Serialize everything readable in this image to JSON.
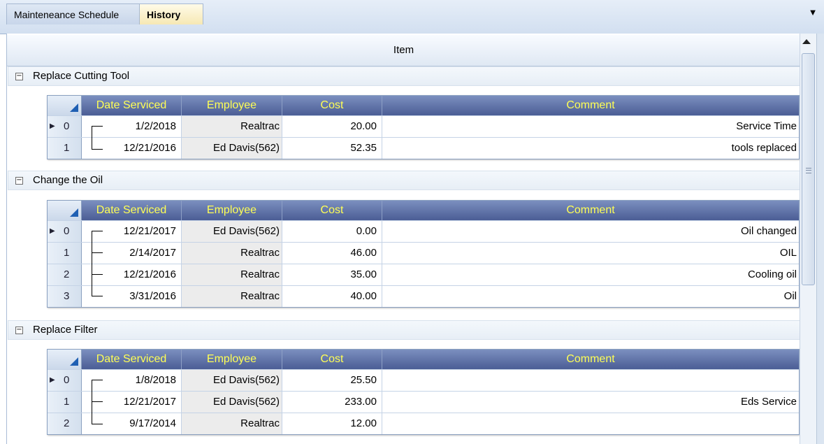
{
  "tabs": [
    {
      "label": "Mainteneance Schedule"
    },
    {
      "label": "History"
    }
  ],
  "grid": {
    "column_header": "Item",
    "detail_columns": [
      "Date Serviced",
      "Employee",
      "Cost",
      "Comment"
    ],
    "groups": [
      {
        "title": "Replace Cutting Tool",
        "rows": [
          {
            "index": "0",
            "date": "1/2/2018",
            "employee": "Realtrac",
            "cost": "20.00",
            "comment": "Service Time"
          },
          {
            "index": "1",
            "date": "12/21/2016",
            "employee": "Ed Davis(562)",
            "cost": "52.35",
            "comment": "tools replaced"
          }
        ]
      },
      {
        "title": "Change the Oil",
        "rows": [
          {
            "index": "0",
            "date": "12/21/2017",
            "employee": "Ed Davis(562)",
            "cost": "0.00",
            "comment": "Oil changed"
          },
          {
            "index": "1",
            "date": "2/14/2017",
            "employee": "Realtrac",
            "cost": "46.00",
            "comment": "OIL"
          },
          {
            "index": "2",
            "date": "12/21/2016",
            "employee": "Realtrac",
            "cost": "35.00",
            "comment": "Cooling oil"
          },
          {
            "index": "3",
            "date": "3/31/2016",
            "employee": "Realtrac",
            "cost": "40.00",
            "comment": "Oil"
          }
        ]
      },
      {
        "title": "Replace Filter",
        "rows": [
          {
            "index": "0",
            "date": "1/8/2018",
            "employee": "Ed Davis(562)",
            "cost": "25.50",
            "comment": ""
          },
          {
            "index": "1",
            "date": "12/21/2017",
            "employee": "Ed Davis(562)",
            "cost": "233.00",
            "comment": "Eds Service"
          },
          {
            "index": "2",
            "date": "9/17/2014",
            "employee": "Realtrac",
            "cost": "12.00",
            "comment": ""
          }
        ]
      }
    ]
  },
  "icons": {
    "dropdown": "chevron-down-icon",
    "collapse": "minus-box-icon",
    "current_row": "row-pointer-icon",
    "corner": "select-all-triangle-icon",
    "scroll_up": "scroll-up-icon"
  },
  "colors": {
    "header_text": "#ffff55",
    "header_bg": "#5a6ca4",
    "corner_triangle": "#1f5fb3"
  }
}
